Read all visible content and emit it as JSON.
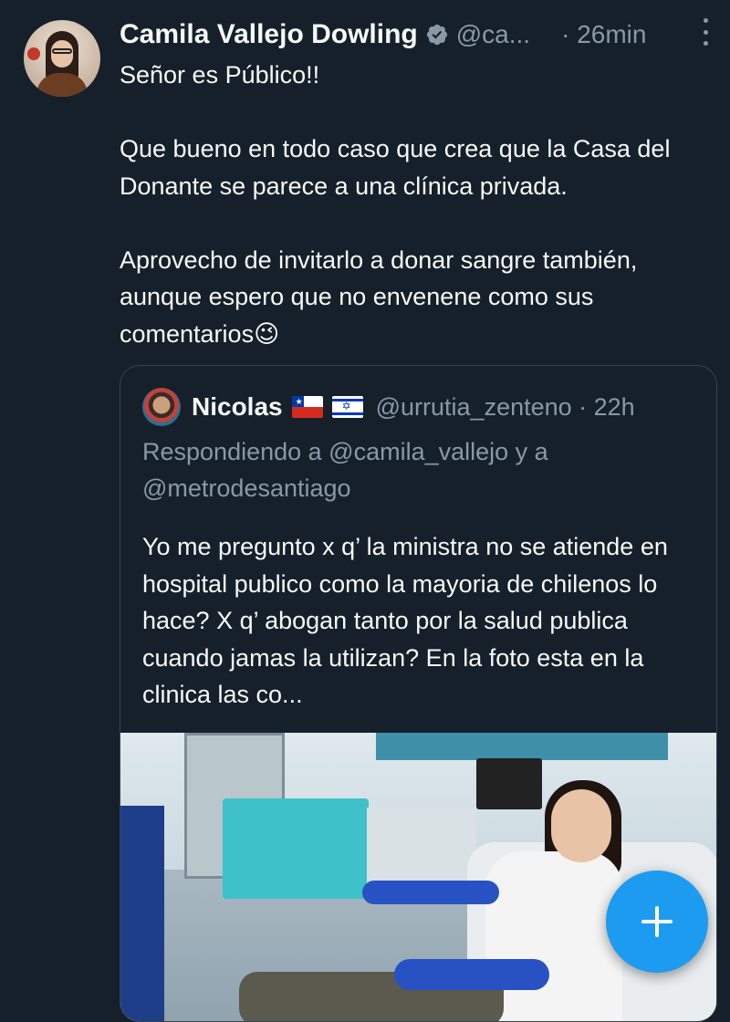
{
  "tweet": {
    "author_name": "Camila Vallejo Dowling",
    "author_handle": "@ca...",
    "time": "· 26min",
    "text": "Señor es Público!!\n\nQue bueno en todo caso que crea que la Casa del Donante se parece a una clínica privada.\n\nAprovecho de invitarlo a donar sangre también, aunque espero que no envenene como sus comentarios😉"
  },
  "quote": {
    "author_name": "Nicolas",
    "author_handle": "@urrutia_zenteno · 22h",
    "flags": [
      "chile-flag-icon",
      "israel-flag-icon"
    ],
    "replying_to": "Respondiendo a @camila_vallejo y a @metrodesantiago",
    "text": "Yo me pregunto x q’ la ministra no se atiende en hospital publico como la mayoria de chilenos lo hace? X q’  abogan tanto por la salud publica cuando jamas la utilizan? En la foto esta en la clinica las co..."
  },
  "icons": {
    "verified": "verified-badge-icon",
    "more": "more-options-icon",
    "compose": "plus-icon"
  },
  "colors": {
    "background": "#15202b",
    "accent": "#1d9bf0",
    "secondary_text": "#8b98a5",
    "border": "#38444d"
  }
}
